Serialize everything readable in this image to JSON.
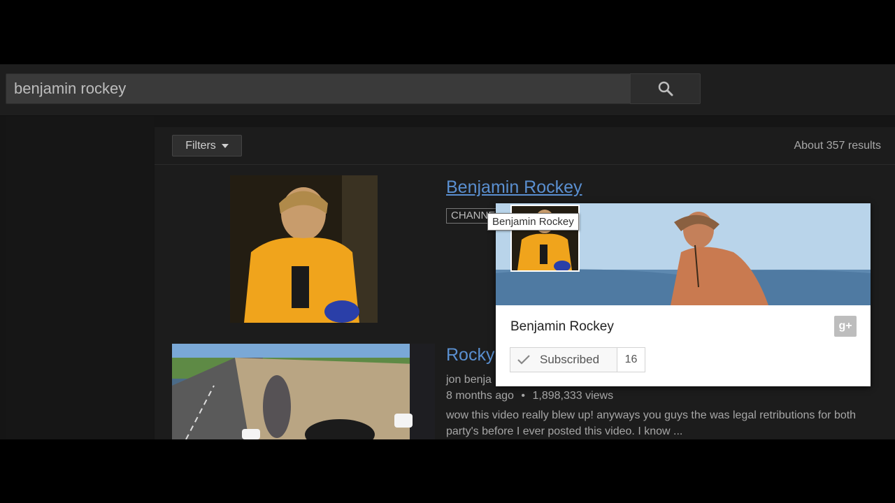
{
  "search": {
    "query": "benjamin rockey",
    "button_icon": "search-icon"
  },
  "toolbar": {
    "filters_label": "Filters",
    "results_count": "About 357 results"
  },
  "results": {
    "channel": {
      "title": "Benjamin Rockey",
      "badge": "CHANNEL"
    },
    "video": {
      "title": "Rocky",
      "channel": "jon benja",
      "age": "8 months ago",
      "views": "1,898,333 views",
      "separator": "•",
      "description": "wow this video really blew up! anyways you guys the was legal retributions for both party's before I ever posted this video. I know ..."
    }
  },
  "hovercard": {
    "name": "Benjamin Rockey",
    "subscribe_label": "Subscribed",
    "subscriber_count": "16",
    "social_icon": "google-plus-icon",
    "gplus_glyph": "g+"
  },
  "tooltip": {
    "text": "Benjamin Rockey"
  },
  "colors": {
    "link": "#5a8fd0",
    "background": "#1c1c1c",
    "masthead": "#1e1e1e"
  }
}
